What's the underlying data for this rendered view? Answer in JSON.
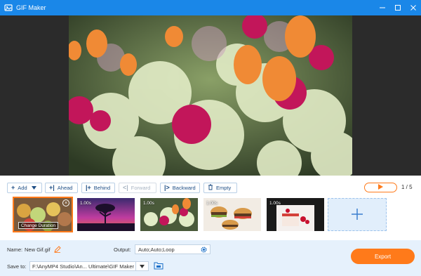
{
  "window": {
    "title": "GIF Maker",
    "controls": [
      "minimize",
      "maximize",
      "close"
    ]
  },
  "toolbar": {
    "add_label": "Add",
    "ahead_label": "Ahead",
    "behind_label": "Behind",
    "forward_label": "Forward",
    "backward_label": "Backward",
    "empty_label": "Empty",
    "page_indicator": "1 / 5"
  },
  "timeline": {
    "clips": [
      {
        "duration": "",
        "selected": true,
        "change_duration_label": "Change Duration"
      },
      {
        "duration": "1.00s"
      },
      {
        "duration": "1.00s"
      },
      {
        "duration": "1.00s"
      },
      {
        "duration": "1.00s"
      }
    ]
  },
  "bottom": {
    "name_label": "Name:",
    "name_value": "New Gif.gif",
    "output_label": "Output:",
    "output_value": "Auto;Auto;Loop",
    "save_label": "Save to:",
    "save_path": "F:\\AnyMP4 Studio\\An... Ultimate\\GIF Maker",
    "export_label": "Export"
  },
  "colors": {
    "accent": "#1a87e8",
    "orange": "#ff7a1a",
    "panel": "#e6f1fc"
  }
}
